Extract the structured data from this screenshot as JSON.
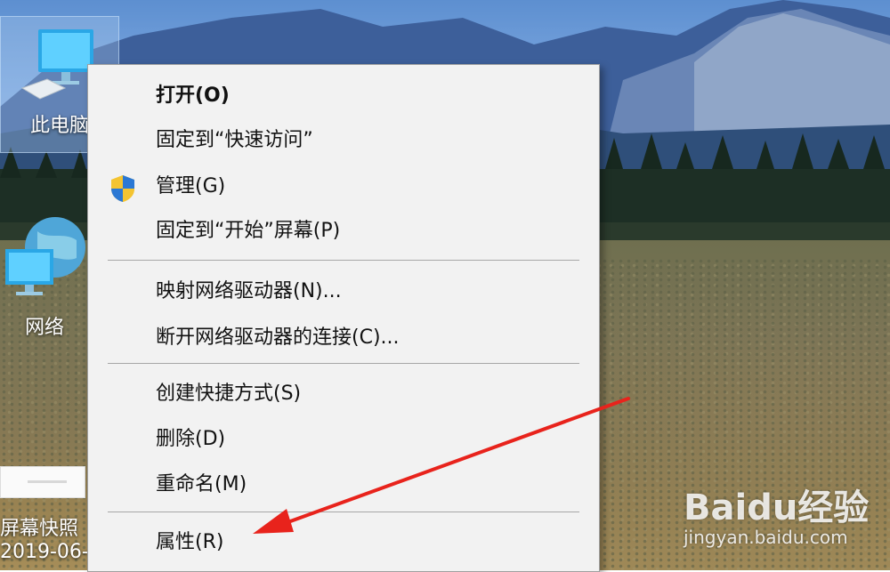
{
  "desktop": {
    "icons": [
      {
        "label": "此电脑",
        "icon": "computer-icon",
        "selected": true
      },
      {
        "label": "网络",
        "icon": "network-globe-icon"
      },
      {
        "label": "屏幕快照",
        "sublabel": "2019-06-",
        "icon": "screenshot-thumbnail"
      }
    ]
  },
  "context_menu": {
    "groups": [
      [
        {
          "label": "打开(O)",
          "bold": true
        },
        {
          "label": "固定到“快速访问”"
        },
        {
          "label": "管理(G)",
          "icon": "uac-shield-icon"
        },
        {
          "label": "固定到“开始”屏幕(P)"
        }
      ],
      [
        {
          "label": "映射网络驱动器(N)..."
        },
        {
          "label": "断开网络驱动器的连接(C)..."
        }
      ],
      [
        {
          "label": "创建快捷方式(S)"
        },
        {
          "label": "删除(D)"
        },
        {
          "label": "重命名(M)"
        }
      ],
      [
        {
          "label": "属性(R)"
        }
      ]
    ]
  },
  "annotation": {
    "type": "red-arrow",
    "color": "#e8231c",
    "points_to": "属性(R)"
  },
  "watermark": {
    "logo": "Baidu经验",
    "url": "jingyan.baidu.com"
  }
}
